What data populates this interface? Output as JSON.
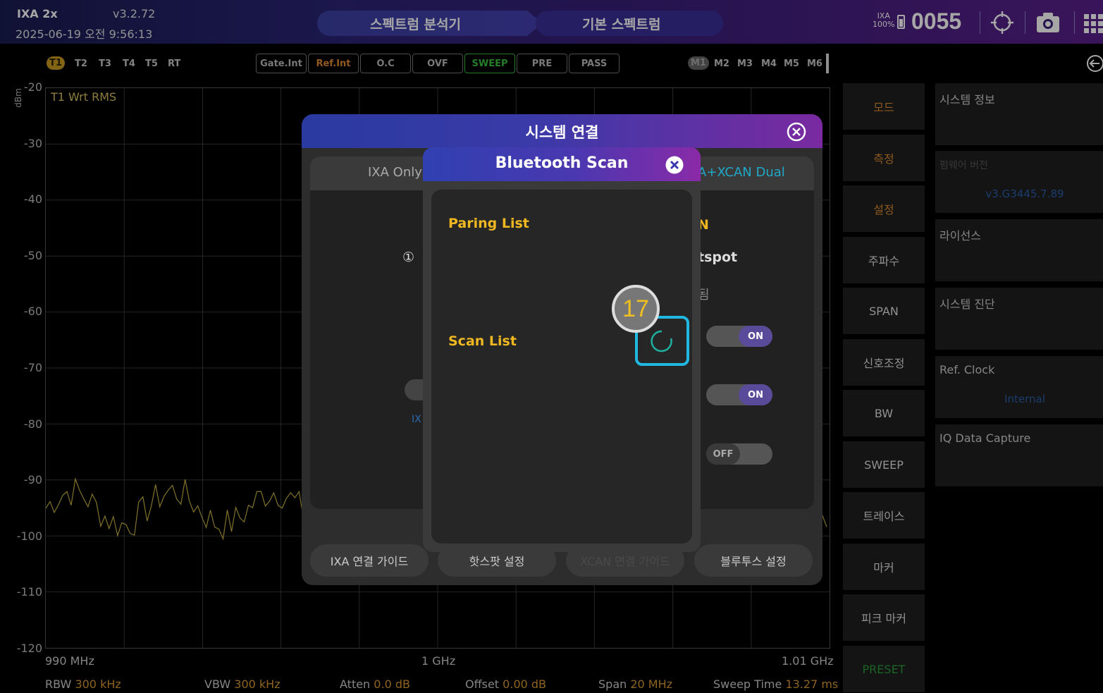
{
  "topbar": {
    "model": "IXA 2x",
    "version": "v3.2.72",
    "datetime": "2025-06-19 오전 9:56:13",
    "tab_mode": "스펙트럼 분석기",
    "tab_measure": "기본 스펙트럼",
    "ixa_label": "IXA",
    "battery_pct": "100%",
    "counter": "0055"
  },
  "traces": [
    "T1",
    "T2",
    "T3",
    "T4",
    "T5",
    "RT"
  ],
  "flags": [
    "Gate.Int",
    "Ref.Int",
    "O.C",
    "OVF",
    "SWEEP",
    "PRE",
    "PASS"
  ],
  "markers": [
    "M1",
    "M2",
    "M3",
    "M4",
    "M5",
    "M6"
  ],
  "chart": {
    "unit": "dBm",
    "trace_label": "T1 Wrt RMS",
    "y_ticks": [
      "-20",
      "-30",
      "-40",
      "-50",
      "-60",
      "-70",
      "-80",
      "-90",
      "-100",
      "-110",
      "-120"
    ],
    "x_start": "990 MHz",
    "x_center": "1 GHz",
    "x_end": "1.01 GHz",
    "trace_color": "#c8b040"
  },
  "status_line": {
    "rbw_label": "RBW",
    "rbw": "300 kHz",
    "vbw_label": "VBW",
    "vbw": "300 kHz",
    "atten_label": "Atten",
    "atten": "0.0 dB",
    "offset_label": "Offset",
    "offset": "0.00 dB",
    "span_label": "Span",
    "span": "20 MHz",
    "sweep_label": "Sweep Time",
    "sweep": "13.27 ms"
  },
  "menu": [
    "모드",
    "측정",
    "설정",
    "주파수",
    "SPAN",
    "신호조정",
    "BW",
    "SWEEP",
    "트레이스",
    "마커",
    "피크 마커",
    "PRESET"
  ],
  "info": {
    "system_info": "시스템 정보",
    "firmware_label": "펌웨어 버전",
    "firmware_value": "v3.G3445.7.89",
    "license": "라이선스",
    "diagnostics": "시스템 진단",
    "ref_clock": "Ref. Clock",
    "ref_clock_value": "Internal",
    "iq_capture": "IQ Data Capture"
  },
  "system_dialog": {
    "title": "시스템 연결",
    "tab_left": "IXA Only",
    "tab_right": "A+XCAN Dual",
    "circled_num": "①",
    "partial_n": "N",
    "partial_hotspot": "tspot",
    "partial_done": "됨",
    "partial_ix": "IX",
    "toggle1": "ON",
    "toggle2": "ON",
    "toggle3": "OFF",
    "btn_ixa_guide": "IXA 연결 가이드",
    "btn_hotspot": "핫스팟 설정",
    "btn_xcan_guide": "XCAN 연결 가이드",
    "btn_bluetooth": "블루투스 설정"
  },
  "bt_dialog": {
    "title": "Bluetooth Scan",
    "pairing_list": "Paring List",
    "scan_list": "Scan List"
  },
  "annotation": {
    "step": "17"
  }
}
